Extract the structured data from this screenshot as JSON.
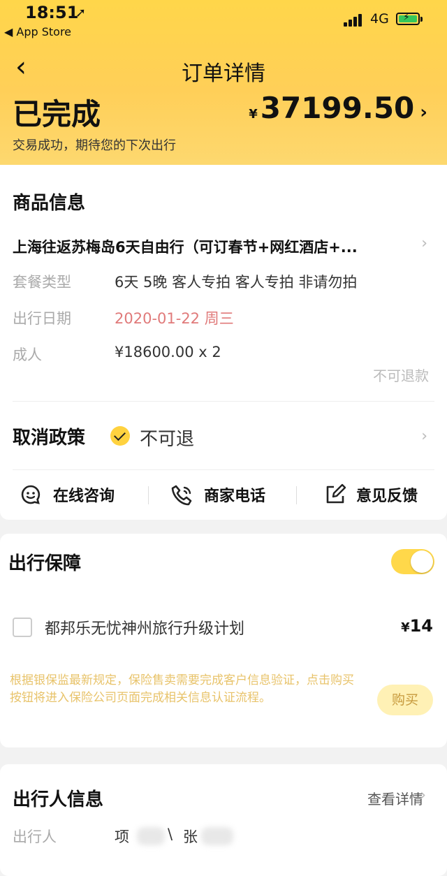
{
  "status_bar": {
    "time": "18:51",
    "back_app": "◀ App Store",
    "network": "4G"
  },
  "nav": {
    "back_icon": "chevron-left-icon",
    "title": "订单详情"
  },
  "order": {
    "status": "已完成",
    "currency": "¥",
    "amount": "37199.50",
    "subtitle": "交易成功，期待您的下次出行"
  },
  "product": {
    "section_title": "商品信息",
    "name": "上海往返苏梅岛6天自由行（可订春节+网红酒店+...",
    "rows": [
      {
        "label": "套餐类型",
        "value": "6天 5晚 客人专拍 客人专拍 非请勿拍"
      },
      {
        "label": "出行日期",
        "value": "2020-01-22 周三"
      },
      {
        "label": "成人",
        "value": "¥18600.00 x 2"
      }
    ],
    "refund_note": "不可退款"
  },
  "cancel_policy": {
    "title": "取消政策",
    "value": "不可退"
  },
  "actions": [
    {
      "label": "在线咨询",
      "icon": "chat-icon"
    },
    {
      "label": "商家电话",
      "icon": "phone-icon"
    },
    {
      "label": "意见反馈",
      "icon": "edit-icon"
    }
  ],
  "insurance": {
    "title": "出行保障",
    "toggle_on": true,
    "plan_name": "都邦乐无忧神州旅行升级计划",
    "plan_currency": "¥",
    "plan_price": "14",
    "notice": "根据银保监最新规定，保险售卖需要完成客户信息验证，点击购买按钮将进入保险公司页面完成相关信息认证流程。",
    "buy_label": "购买"
  },
  "traveler": {
    "title": "出行人信息",
    "detail_link": "查看详情",
    "label": "出行人",
    "names": [
      "项",
      "\\",
      "张"
    ]
  },
  "colors": {
    "accent": "#ffd23f",
    "header_bg": "#ffd64a",
    "date_red": "#e07a7a"
  }
}
